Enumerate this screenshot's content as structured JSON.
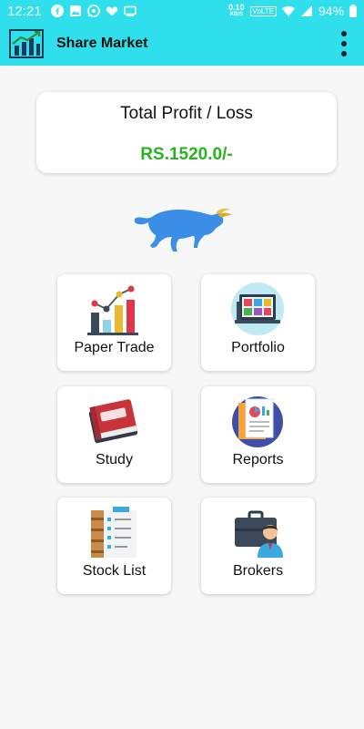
{
  "status_bar": {
    "time": "12:21",
    "net_speed": "0.10",
    "net_unit": "KB/S",
    "network_label": "VoLTE",
    "battery": "94%",
    "left_icons": [
      "facebook-icon",
      "image-icon",
      "whatsapp-icon",
      "heart-icon",
      "monitor-icon"
    ]
  },
  "app_bar": {
    "title": "Share Market",
    "logo_icon": "chart-logo-icon",
    "menu_icon": "more-vert-icon"
  },
  "profit_card": {
    "title": "Total Profit / Loss",
    "value": "RS.1520.0/-",
    "value_color": "#2bb31f"
  },
  "colors": {
    "accent": "#2fe0ec",
    "bull": "#3a8ee6"
  },
  "tiles": [
    {
      "label": "Paper Trade",
      "icon": "bar-chart-icon"
    },
    {
      "label": "Portfolio",
      "icon": "laptop-dashboard-icon"
    },
    {
      "label": "Study",
      "icon": "book-icon"
    },
    {
      "label": "Reports",
      "icon": "report-documents-icon"
    },
    {
      "label": "Stock List",
      "icon": "clipboard-list-icon"
    },
    {
      "label": "Brokers",
      "icon": "broker-briefcase-icon"
    }
  ]
}
